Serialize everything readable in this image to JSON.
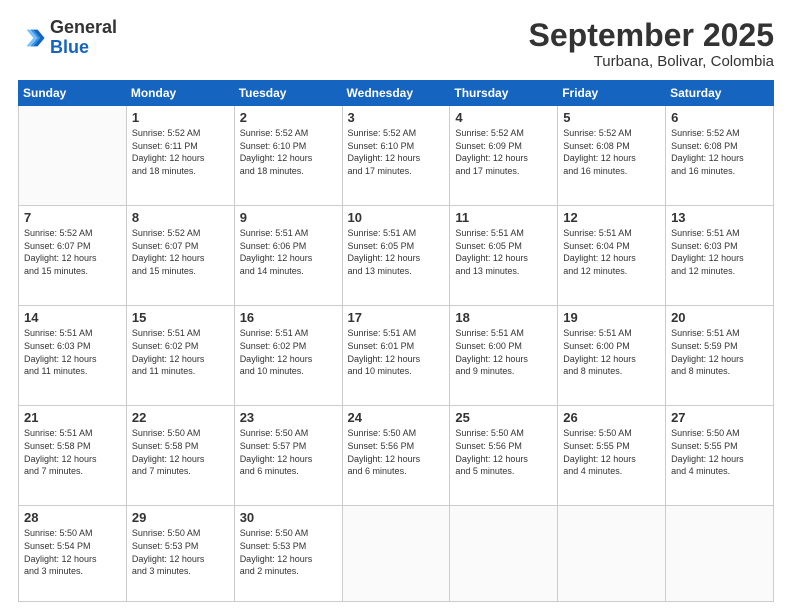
{
  "logo": {
    "general": "General",
    "blue": "Blue"
  },
  "header": {
    "month": "September 2025",
    "location": "Turbana, Bolivar, Colombia"
  },
  "weekdays": [
    "Sunday",
    "Monday",
    "Tuesday",
    "Wednesday",
    "Thursday",
    "Friday",
    "Saturday"
  ],
  "weeks": [
    [
      {
        "day": "",
        "info": ""
      },
      {
        "day": "1",
        "info": "Sunrise: 5:52 AM\nSunset: 6:11 PM\nDaylight: 12 hours\nand 18 minutes."
      },
      {
        "day": "2",
        "info": "Sunrise: 5:52 AM\nSunset: 6:10 PM\nDaylight: 12 hours\nand 18 minutes."
      },
      {
        "day": "3",
        "info": "Sunrise: 5:52 AM\nSunset: 6:10 PM\nDaylight: 12 hours\nand 17 minutes."
      },
      {
        "day": "4",
        "info": "Sunrise: 5:52 AM\nSunset: 6:09 PM\nDaylight: 12 hours\nand 17 minutes."
      },
      {
        "day": "5",
        "info": "Sunrise: 5:52 AM\nSunset: 6:08 PM\nDaylight: 12 hours\nand 16 minutes."
      },
      {
        "day": "6",
        "info": "Sunrise: 5:52 AM\nSunset: 6:08 PM\nDaylight: 12 hours\nand 16 minutes."
      }
    ],
    [
      {
        "day": "7",
        "info": "Sunrise: 5:52 AM\nSunset: 6:07 PM\nDaylight: 12 hours\nand 15 minutes."
      },
      {
        "day": "8",
        "info": "Sunrise: 5:52 AM\nSunset: 6:07 PM\nDaylight: 12 hours\nand 15 minutes."
      },
      {
        "day": "9",
        "info": "Sunrise: 5:51 AM\nSunset: 6:06 PM\nDaylight: 12 hours\nand 14 minutes."
      },
      {
        "day": "10",
        "info": "Sunrise: 5:51 AM\nSunset: 6:05 PM\nDaylight: 12 hours\nand 13 minutes."
      },
      {
        "day": "11",
        "info": "Sunrise: 5:51 AM\nSunset: 6:05 PM\nDaylight: 12 hours\nand 13 minutes."
      },
      {
        "day": "12",
        "info": "Sunrise: 5:51 AM\nSunset: 6:04 PM\nDaylight: 12 hours\nand 12 minutes."
      },
      {
        "day": "13",
        "info": "Sunrise: 5:51 AM\nSunset: 6:03 PM\nDaylight: 12 hours\nand 12 minutes."
      }
    ],
    [
      {
        "day": "14",
        "info": "Sunrise: 5:51 AM\nSunset: 6:03 PM\nDaylight: 12 hours\nand 11 minutes."
      },
      {
        "day": "15",
        "info": "Sunrise: 5:51 AM\nSunset: 6:02 PM\nDaylight: 12 hours\nand 11 minutes."
      },
      {
        "day": "16",
        "info": "Sunrise: 5:51 AM\nSunset: 6:02 PM\nDaylight: 12 hours\nand 10 minutes."
      },
      {
        "day": "17",
        "info": "Sunrise: 5:51 AM\nSunset: 6:01 PM\nDaylight: 12 hours\nand 10 minutes."
      },
      {
        "day": "18",
        "info": "Sunrise: 5:51 AM\nSunset: 6:00 PM\nDaylight: 12 hours\nand 9 minutes."
      },
      {
        "day": "19",
        "info": "Sunrise: 5:51 AM\nSunset: 6:00 PM\nDaylight: 12 hours\nand 8 minutes."
      },
      {
        "day": "20",
        "info": "Sunrise: 5:51 AM\nSunset: 5:59 PM\nDaylight: 12 hours\nand 8 minutes."
      }
    ],
    [
      {
        "day": "21",
        "info": "Sunrise: 5:51 AM\nSunset: 5:58 PM\nDaylight: 12 hours\nand 7 minutes."
      },
      {
        "day": "22",
        "info": "Sunrise: 5:50 AM\nSunset: 5:58 PM\nDaylight: 12 hours\nand 7 minutes."
      },
      {
        "day": "23",
        "info": "Sunrise: 5:50 AM\nSunset: 5:57 PM\nDaylight: 12 hours\nand 6 minutes."
      },
      {
        "day": "24",
        "info": "Sunrise: 5:50 AM\nSunset: 5:56 PM\nDaylight: 12 hours\nand 6 minutes."
      },
      {
        "day": "25",
        "info": "Sunrise: 5:50 AM\nSunset: 5:56 PM\nDaylight: 12 hours\nand 5 minutes."
      },
      {
        "day": "26",
        "info": "Sunrise: 5:50 AM\nSunset: 5:55 PM\nDaylight: 12 hours\nand 4 minutes."
      },
      {
        "day": "27",
        "info": "Sunrise: 5:50 AM\nSunset: 5:55 PM\nDaylight: 12 hours\nand 4 minutes."
      }
    ],
    [
      {
        "day": "28",
        "info": "Sunrise: 5:50 AM\nSunset: 5:54 PM\nDaylight: 12 hours\nand 3 minutes."
      },
      {
        "day": "29",
        "info": "Sunrise: 5:50 AM\nSunset: 5:53 PM\nDaylight: 12 hours\nand 3 minutes."
      },
      {
        "day": "30",
        "info": "Sunrise: 5:50 AM\nSunset: 5:53 PM\nDaylight: 12 hours\nand 2 minutes."
      },
      {
        "day": "",
        "info": ""
      },
      {
        "day": "",
        "info": ""
      },
      {
        "day": "",
        "info": ""
      },
      {
        "day": "",
        "info": ""
      }
    ]
  ]
}
